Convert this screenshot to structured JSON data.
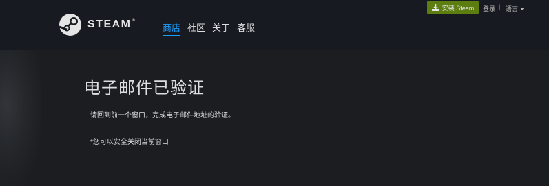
{
  "header": {
    "logo_text": "STEAM",
    "logo_reg": "®",
    "nav": [
      "商店",
      "社区",
      "关于",
      "客服"
    ],
    "active_nav": "商店",
    "install_button": "安装 Steam",
    "login": "登录",
    "separator": "|",
    "language": "语言"
  },
  "content": {
    "title": "电子邮件已验证",
    "message": "请回到前一个窗口，完成电子邮件地址的验证。",
    "note": "*您可以安全关闭当前窗口"
  },
  "colors": {
    "background": "#1b1d20",
    "header": "#171a21",
    "accent_green": "#5c7e10",
    "active_nav": "#1a9fff"
  },
  "icons": [
    "steam-logo-icon",
    "install-icon",
    "chevron-down-icon"
  ]
}
